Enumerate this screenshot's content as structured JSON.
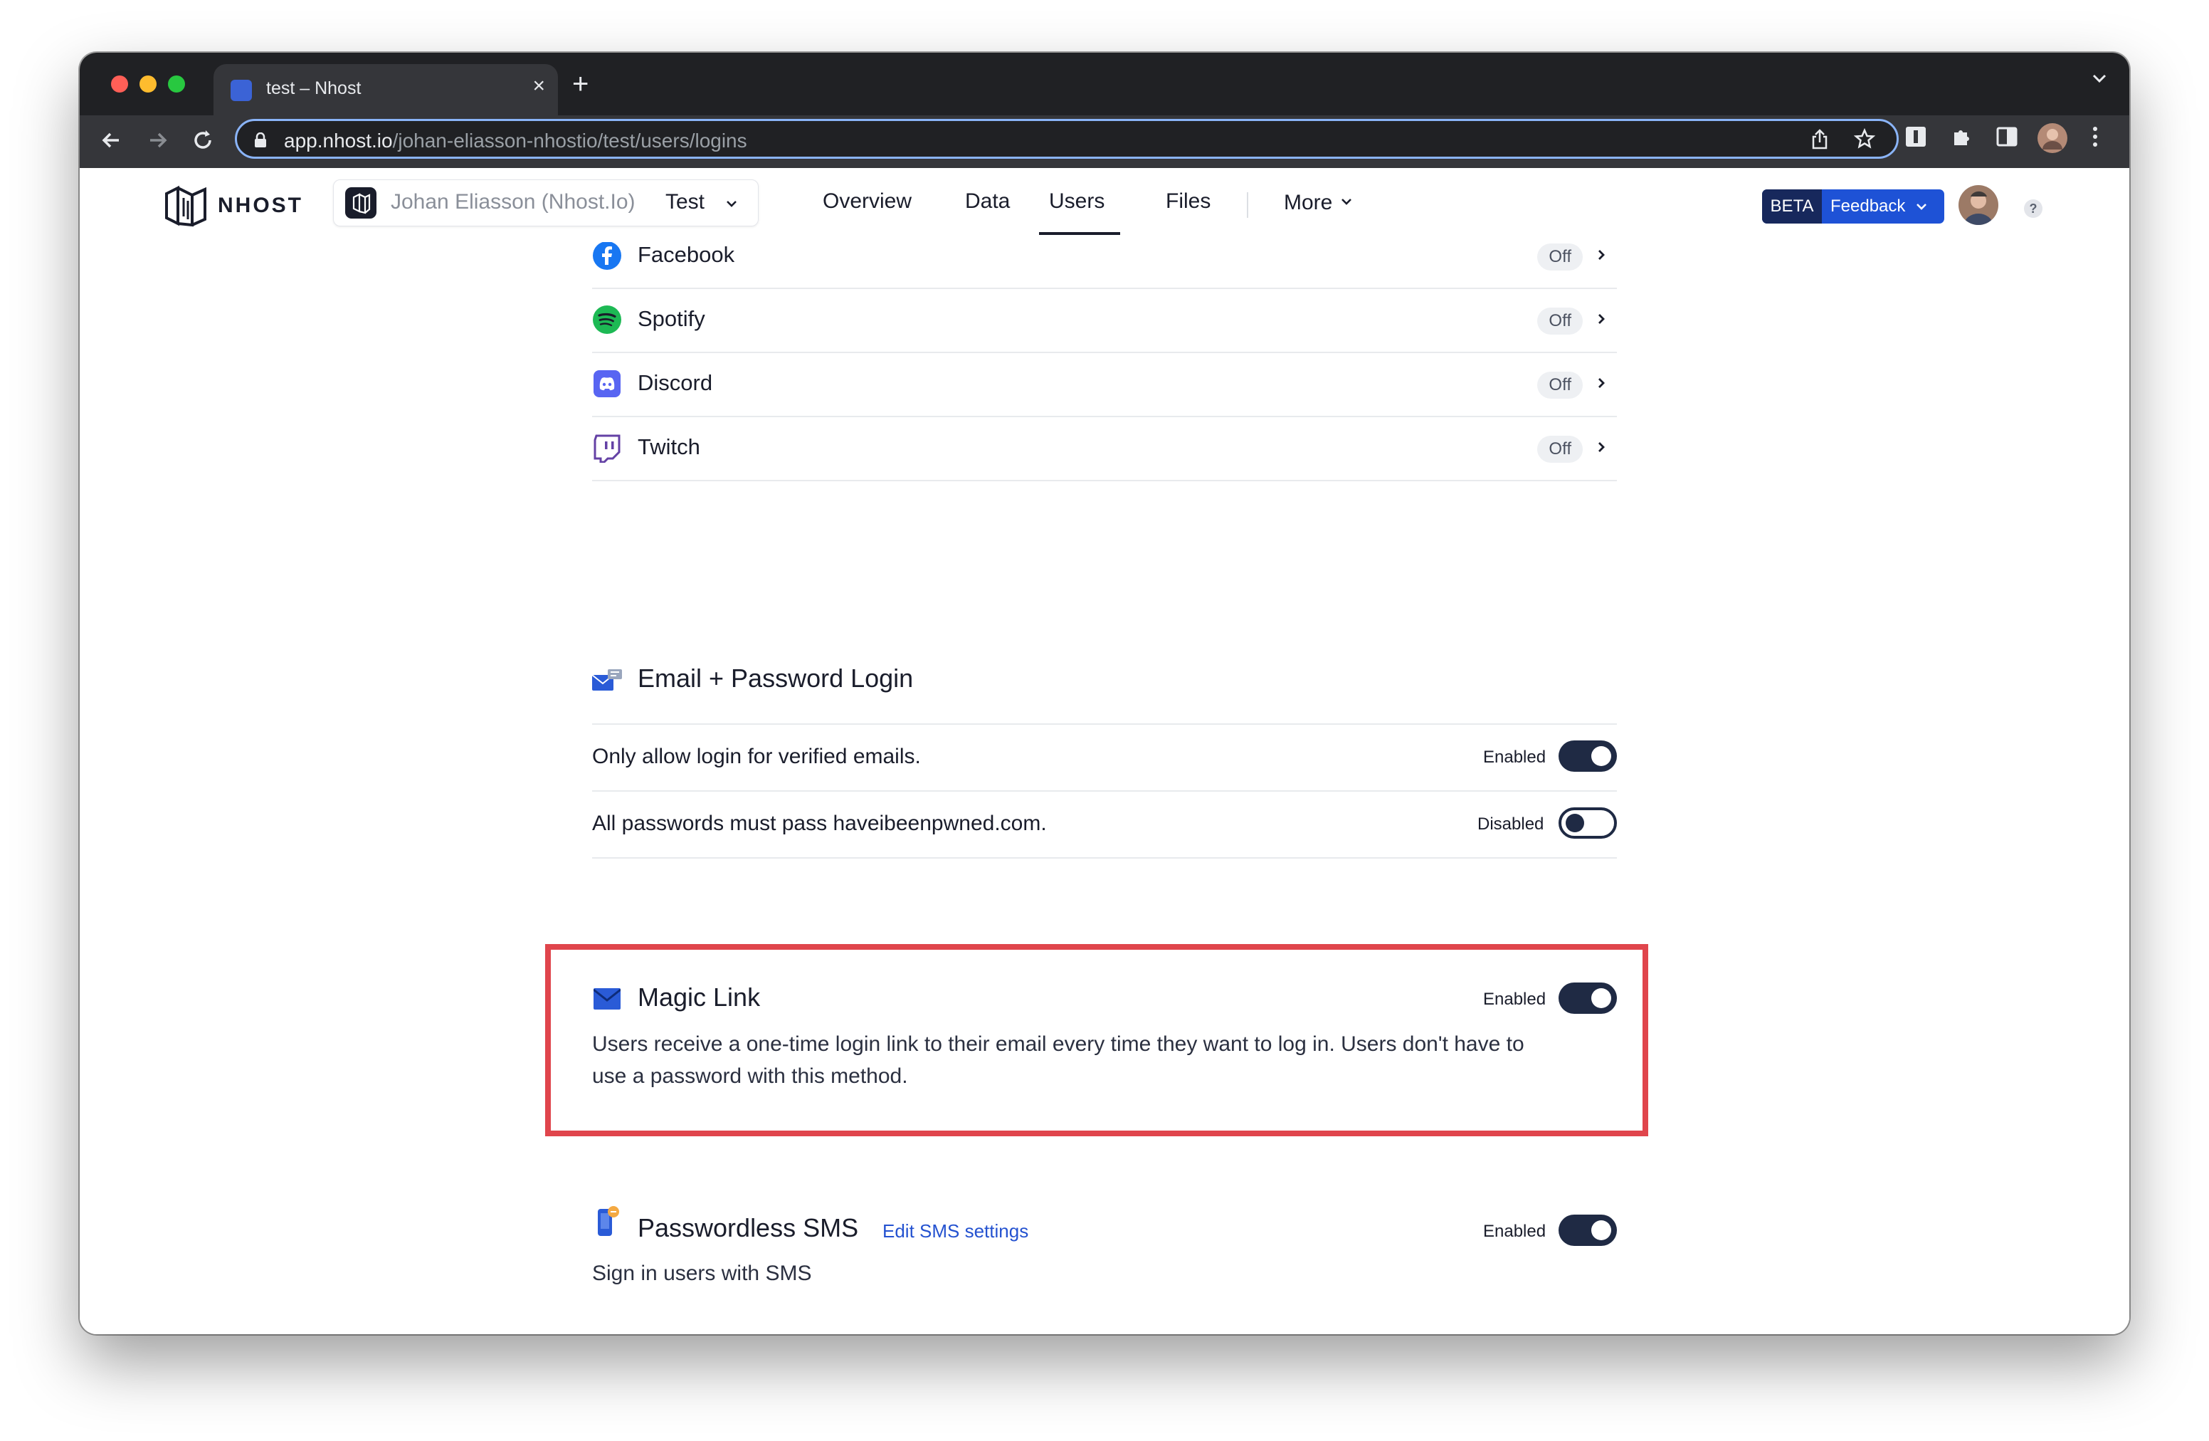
{
  "browser": {
    "tab": {
      "title": "test – Nhost",
      "close_glyph": "×"
    },
    "new_tab_glyph": "+",
    "url": {
      "host": "app.nhost.io",
      "path": "/johan-eliasson-nhostio/test/users/logins"
    }
  },
  "header": {
    "logo_text": "NHOST",
    "project": {
      "workspace": "Johan Eliasson (Nhost.Io)",
      "name": "Test"
    },
    "nav": [
      {
        "label": "Overview"
      },
      {
        "label": "Data"
      },
      {
        "label": "Users"
      },
      {
        "label": "Files"
      }
    ],
    "active_nav": "Users",
    "more_label": "More",
    "feedback": {
      "badge": "BETA",
      "label": "Feedback"
    },
    "help_label": "?"
  },
  "providers": [
    {
      "label": "Facebook",
      "status": "Off",
      "icon": "facebook-icon"
    },
    {
      "label": "Spotify",
      "status": "Off",
      "icon": "spotify-icon"
    },
    {
      "label": "Discord",
      "status": "Off",
      "icon": "discord-icon"
    },
    {
      "label": "Twitch",
      "status": "Off",
      "icon": "twitch-icon"
    }
  ],
  "email_password": {
    "title": "Email + Password Login",
    "settings": [
      {
        "label": "Only allow login for verified emails.",
        "state": "Enabled",
        "on": true
      },
      {
        "label": "All passwords must pass haveibeenpwned.com.",
        "state": "Disabled",
        "on": false
      }
    ]
  },
  "magic_link": {
    "title": "Magic Link",
    "state": "Enabled",
    "description_line1": "Users receive a one-time login link to their email every time they want to log in. Users don't have to",
    "description_line2": "use a password with this method."
  },
  "passwordless_sms": {
    "title": "Passwordless SMS",
    "link": "Edit SMS settings",
    "state": "Enabled",
    "description": "Sign in users with SMS"
  },
  "colors": {
    "accent": "#1e52d6",
    "toggle_on": "#1f2a44",
    "highlight": "#e0454c",
    "beta_badge": "#17285c"
  }
}
